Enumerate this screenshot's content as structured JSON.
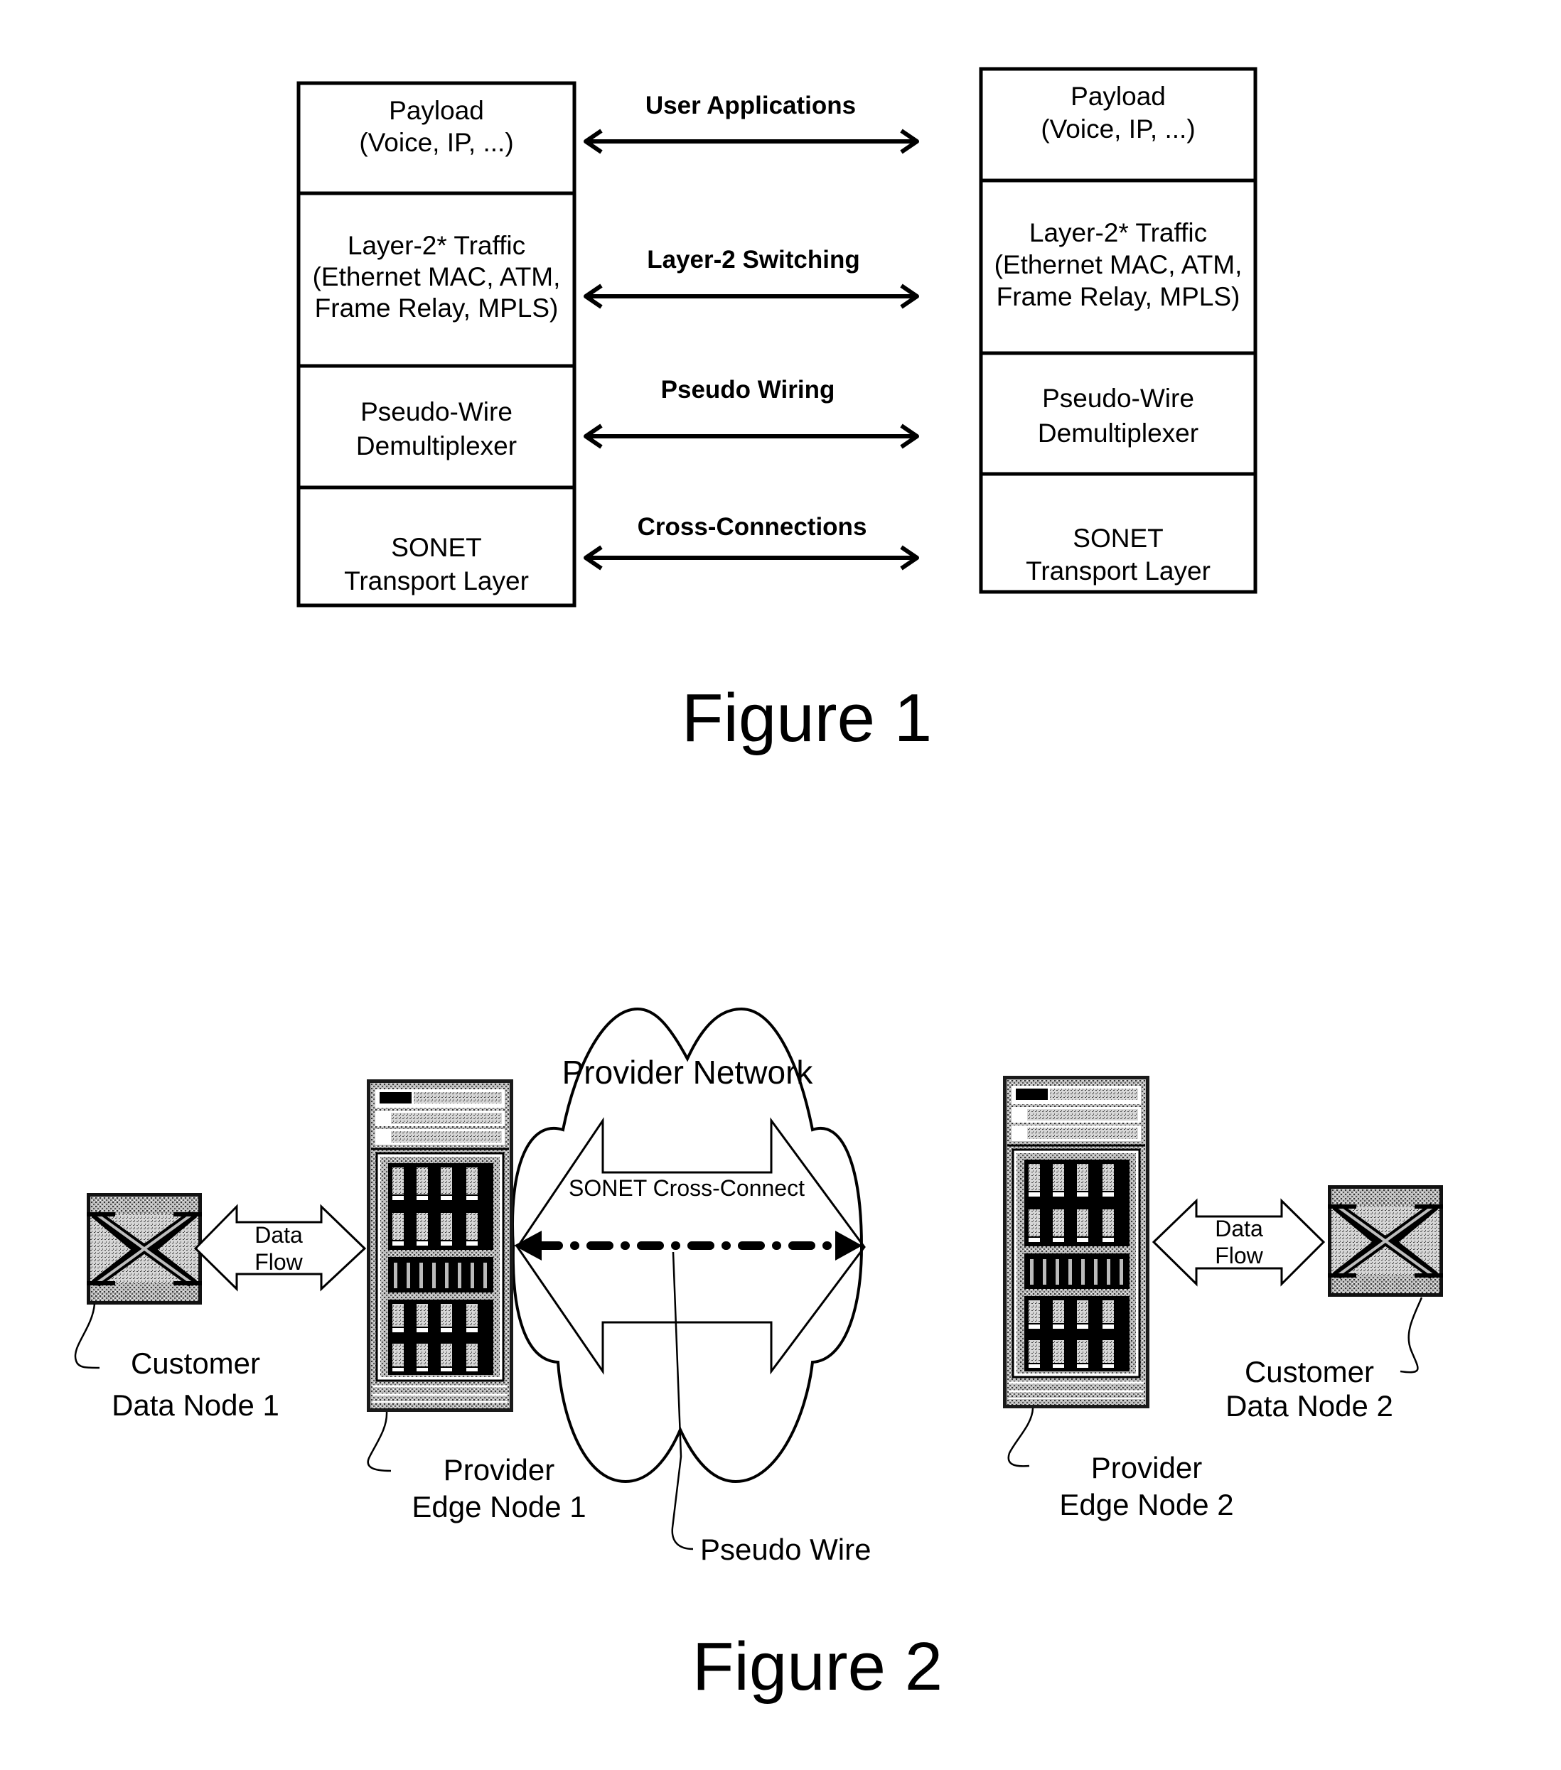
{
  "figure1": {
    "caption": "Figure 1",
    "left_stack": [
      {
        "line1": "Payload",
        "line2": "(Voice, IP, ...)",
        "line3": ""
      },
      {
        "line1": "Layer-2* Traffic",
        "line2": "(Ethernet MAC, ATM,",
        "line3": "Frame Relay, MPLS)"
      },
      {
        "line1": "Pseudo-Wire",
        "line2": "Demultiplexer",
        "line3": ""
      },
      {
        "line1": "SONET",
        "line2": "Transport Layer",
        "line3": ""
      }
    ],
    "right_stack": [
      {
        "line1": "Payload",
        "line2": "(Voice, IP, ...)",
        "line3": ""
      },
      {
        "line1": "Layer-2* Traffic",
        "line2": "(Ethernet MAC, ATM,",
        "line3": "Frame Relay, MPLS)"
      },
      {
        "line1": "Pseudo-Wire",
        "line2": "Demultiplexer",
        "line3": ""
      },
      {
        "line1": "SONET",
        "line2": "Transport Layer",
        "line3": ""
      }
    ],
    "connections": [
      "User Applications",
      "Layer-2 Switching",
      "Pseudo Wiring",
      "Cross-Connections"
    ]
  },
  "figure2": {
    "caption": "Figure 2",
    "cloud_label": "Provider Network",
    "cross_connect_label": "SONET Cross-Connect",
    "pseudo_wire_label": "Pseudo Wire",
    "data_flow_left": {
      "line1": "Data",
      "line2": "Flow"
    },
    "data_flow_right": {
      "line1": "Data",
      "line2": "Flow"
    },
    "customer_node_1": {
      "line1": "Customer",
      "line2": "Data Node 1"
    },
    "customer_node_2": {
      "line1": "Customer",
      "line2": "Data Node 2"
    },
    "provider_edge_1": {
      "line1": "Provider",
      "line2": "Edge Node 1"
    },
    "provider_edge_2": {
      "line1": "Provider",
      "line2": "Edge Node 2"
    }
  }
}
